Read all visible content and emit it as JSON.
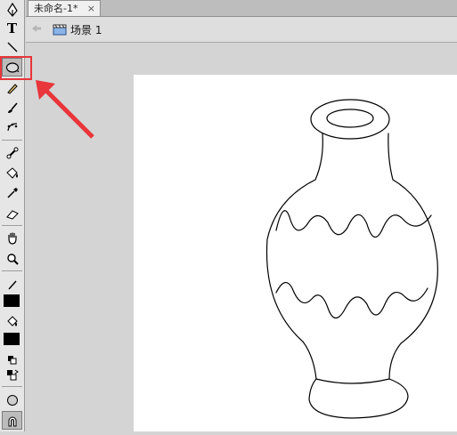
{
  "document": {
    "tab_title": "未命名-1*",
    "tab_close": "×",
    "scene_label": "场景 1"
  },
  "toolbar": {
    "tools": [
      "pen-tool",
      "text-tool",
      "line-tool",
      "oval-tool",
      "pencil-tool",
      "brush-tool",
      "deco-tool",
      "bone-tool",
      "paint-bucket-tool",
      "eyedropper-tool",
      "eraser-tool",
      "hand-tool",
      "zoom-tool",
      "stroke-color",
      "fill-color",
      "swap-colors",
      "object-drawing",
      "snap-to-objects"
    ],
    "text_tool_glyph": "T",
    "selected_tool": "oval-tool"
  },
  "colors": {
    "annotation": "#e8363a",
    "stroke_color": "#000000",
    "fill_color": "#000000",
    "stage_background": "#ffffff"
  }
}
